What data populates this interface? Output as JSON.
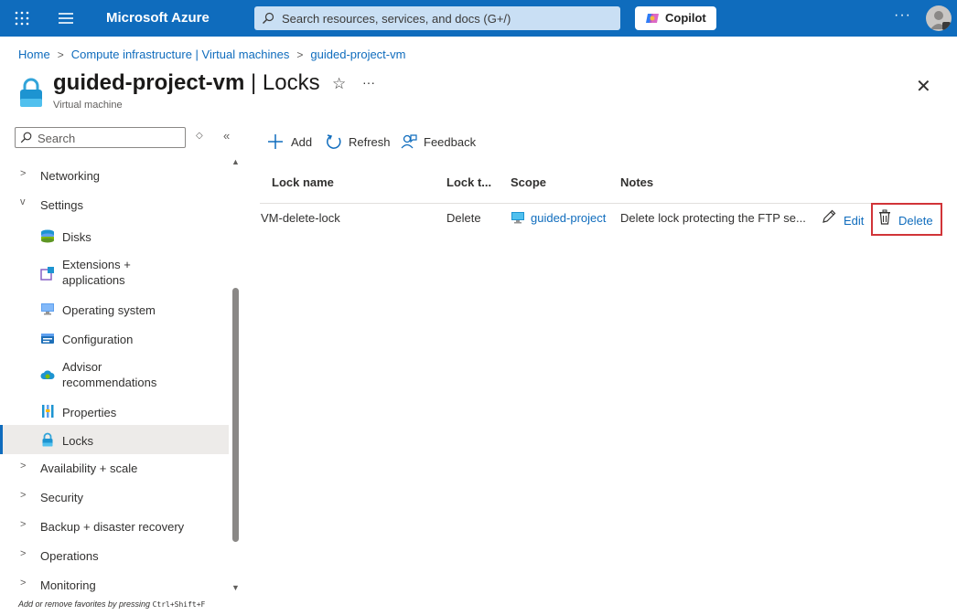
{
  "topbar": {
    "brand": "Microsoft Azure",
    "search_placeholder": "Search resources, services, and docs (G+/)",
    "copilot_label": "Copilot",
    "more_label": "···",
    "icons": [
      "waffle-icon",
      "hamburger-icon",
      "search-icon",
      "copilot-icon",
      "avatar-icon"
    ]
  },
  "breadcrumb": {
    "items": [
      "Home",
      "Compute infrastructure | Virtual machines",
      "guided-project-vm"
    ],
    "separator": ">"
  },
  "header": {
    "resource_name": "guided-project-vm",
    "page_name": "| Locks",
    "subtitle": "Virtual machine",
    "star": "☆",
    "more": "···",
    "close": "✕"
  },
  "sidebar": {
    "search_placeholder": "Search",
    "updown": "◇",
    "collapse": "«",
    "items": [
      {
        "label": "Networking",
        "chevron": ">",
        "level": 0
      },
      {
        "label": "Settings",
        "chevron": "v",
        "level": 0
      },
      {
        "label": "Disks",
        "icon": "disks-icon",
        "level": 1
      },
      {
        "label": "Extensions +\napplications",
        "icon": "extensions-icon",
        "level": 1
      },
      {
        "label": "Operating system",
        "icon": "monitor-icon",
        "level": 1
      },
      {
        "label": "Configuration",
        "icon": "configuration-icon",
        "level": 1
      },
      {
        "label": "Advisor\nrecommendations",
        "icon": "advisor-icon",
        "level": 1
      },
      {
        "label": "Properties",
        "icon": "properties-icon",
        "level": 1
      },
      {
        "label": "Locks",
        "icon": "lock-icon",
        "level": 1,
        "active": true
      },
      {
        "label": "Availability + scale",
        "chevron": ">",
        "level": 0
      },
      {
        "label": "Security",
        "chevron": ">",
        "level": 0
      },
      {
        "label": "Backup + disaster recovery",
        "chevron": ">",
        "level": 0
      },
      {
        "label": "Operations",
        "chevron": ">",
        "level": 0
      },
      {
        "label": "Monitoring",
        "chevron": ">",
        "level": 0
      }
    ],
    "footer_text": "Add or remove favorites by pressing ",
    "footer_shortcut": "Ctrl+Shift+F"
  },
  "toolbar": {
    "add_label": "Add",
    "refresh_label": "Refresh",
    "feedback_label": "Feedback"
  },
  "table": {
    "headers": [
      "Lock name",
      "Lock t...",
      "Scope",
      "Notes"
    ],
    "rows": [
      {
        "lock_name": "VM-delete-lock",
        "lock_type": "Delete",
        "scope": "guided-project",
        "notes": "Delete lock protecting the FTP se...",
        "edit_label": "Edit",
        "delete_label": "Delete"
      }
    ]
  },
  "colors": {
    "topbar": "#0f6cbd",
    "link": "#0f6cbd",
    "highlight_border": "#d13438"
  }
}
